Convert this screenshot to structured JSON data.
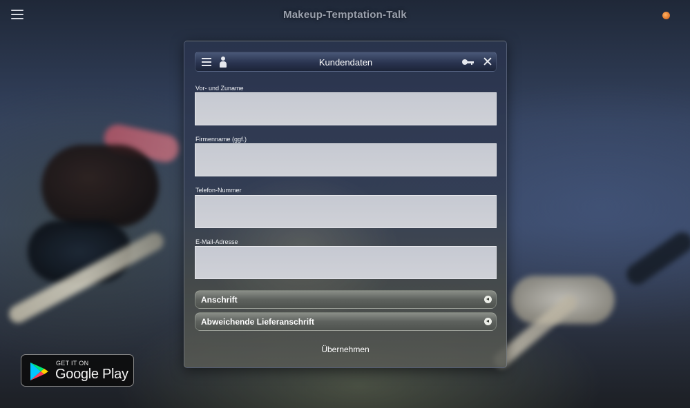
{
  "app": {
    "title": "Makeup-Temptation-Talk"
  },
  "dialog": {
    "title": "Kundendaten",
    "fields": [
      {
        "label": "Vor- und Zuname",
        "value": ""
      },
      {
        "label": "Firmenname (ggf.)",
        "value": ""
      },
      {
        "label": "Telefon-Nummer",
        "value": ""
      },
      {
        "label": "E-Mail-Adresse",
        "value": ""
      }
    ],
    "sections": [
      {
        "label": "Anschrift"
      },
      {
        "label": "Abweichende Lieferanschrift"
      }
    ],
    "apply_label": "Übernehmen"
  },
  "badge": {
    "small": "GET IT ON",
    "big": "Google Play"
  },
  "icons": {
    "app_menu": "hamburger-menu-icon",
    "dialog_menu": "hamburger-menu-icon",
    "user": "person-icon",
    "key": "key-icon",
    "close": "close-icon",
    "section_toggle": "chevron-left-icon",
    "status": "status-dot-icon"
  },
  "colors": {
    "status_dot": "#e2761c",
    "input_bg": "#cbced5",
    "header_bg": "#2a3450"
  }
}
